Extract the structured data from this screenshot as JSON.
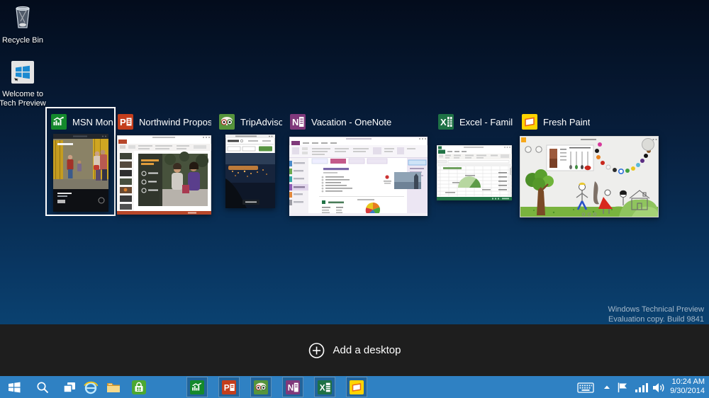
{
  "desktop": {
    "icons": [
      {
        "name": "recycle-bin",
        "label": "Recycle Bin"
      },
      {
        "name": "welcome-tech-preview",
        "label": "Welcome to Tech Preview"
      }
    ],
    "watermark": {
      "line1": "Windows Technical Preview",
      "line2": "Evaluation copy. Build 9841"
    }
  },
  "task_view": {
    "items": [
      {
        "app": "msn-money",
        "title": "MSN Mon...",
        "selected": true
      },
      {
        "app": "powerpoint",
        "title": "Northwind Proposa...",
        "selected": false
      },
      {
        "app": "tripadvisor",
        "title": "TripAdvisor...",
        "selected": false
      },
      {
        "app": "onenote",
        "title": "Vacation - OneNote",
        "selected": false
      },
      {
        "app": "excel",
        "title": "Excel - Family...",
        "selected": false
      },
      {
        "app": "fresh-paint",
        "title": "Fresh Paint",
        "selected": false
      }
    ],
    "add_desktop_label": "Add a desktop"
  },
  "taskbar": {
    "launcher_icons": [
      "start",
      "search",
      "task-view",
      "internet-explorer",
      "file-explorer",
      "store"
    ],
    "running_app_icons": [
      "msn-money",
      "powerpoint",
      "tripadvisor",
      "onenote",
      "excel",
      "fresh-paint"
    ],
    "tray_icons": [
      "touch-keyboard",
      "show-hidden-chevron",
      "action-center-flag",
      "network-signal",
      "volume-speaker"
    ],
    "clock": {
      "time": "10:24 AM",
      "date": "9/30/2014"
    }
  },
  "colors": {
    "taskbar": "#2f81c3",
    "task_strip": "#1e1e1e",
    "selection_border": "#ffffff",
    "excel_green": "#1E7145",
    "onenote_purple": "#80397B",
    "powerpoint_orange": "#C43E1C",
    "msn_green": "#14892c",
    "freshpaint_yellow": "#FFD400"
  }
}
